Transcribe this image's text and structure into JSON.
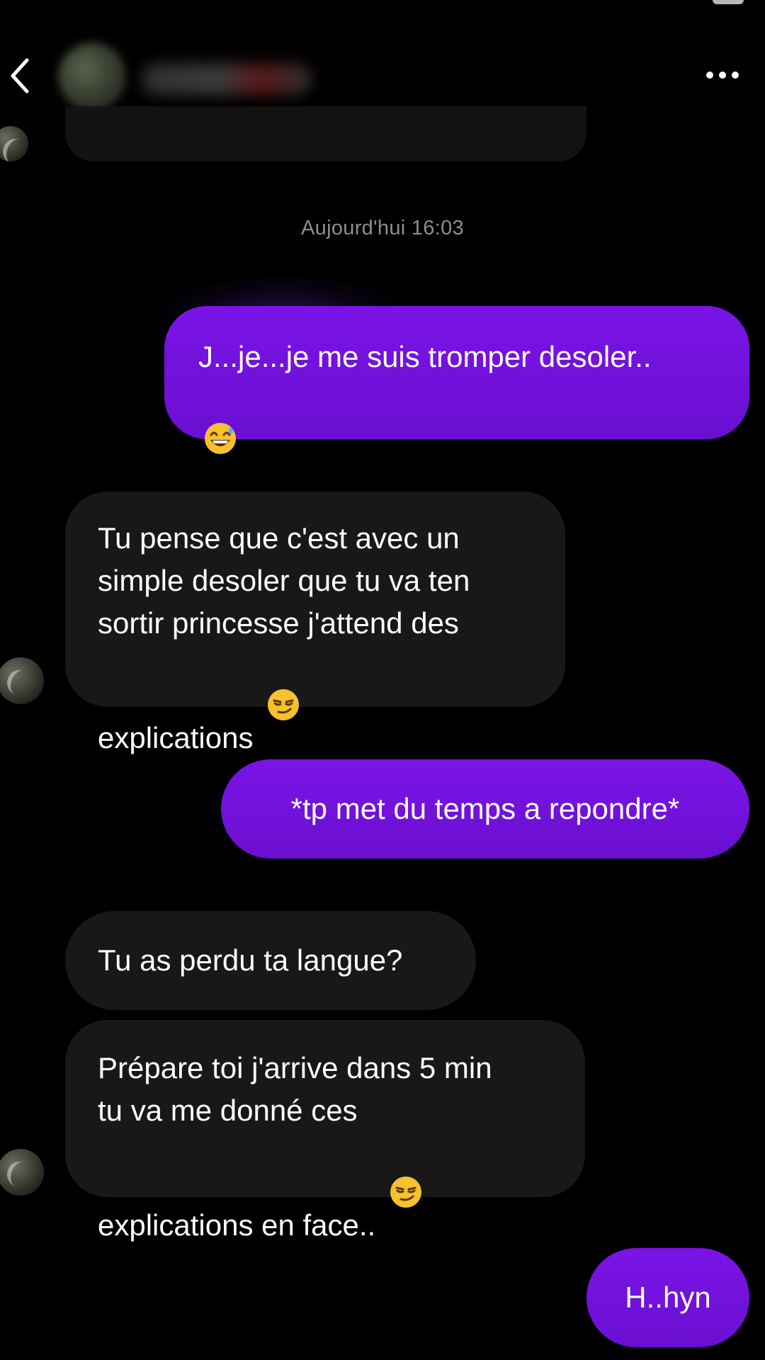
{
  "header": {
    "back_icon": "chevron-left-icon",
    "more_icon": "more-horizontal-icon"
  },
  "conversation": {
    "timestamp": "Aujourd'hui 16:03",
    "messages": [
      {
        "sender": "me",
        "text": "J...je...je me suis tromper desoler..",
        "emoji": "grinning-sweat-emoji"
      },
      {
        "sender": "them",
        "text": "Tu pense que c'est avec un\nsimple desoler que tu va ten\nsortir princesse j'attend des\nexplications",
        "emoji": "smirk-emoji"
      },
      {
        "sender": "me",
        "text": "*tp met du temps a repondre*"
      },
      {
        "sender": "them",
        "text": "Tu as perdu ta langue?"
      },
      {
        "sender": "them",
        "text": "Prépare toi j'arrive dans 5 min\ntu va me donné ces\nexplications en face..",
        "emoji": "smirk-emoji"
      },
      {
        "sender": "me",
        "text": "H..hyn"
      }
    ]
  },
  "colors": {
    "background": "#000000",
    "sent_bubble": "#7010DB",
    "received_bubble": "#181818",
    "timestamp_text": "#8D8D8D",
    "text": "#FFFFFF"
  }
}
